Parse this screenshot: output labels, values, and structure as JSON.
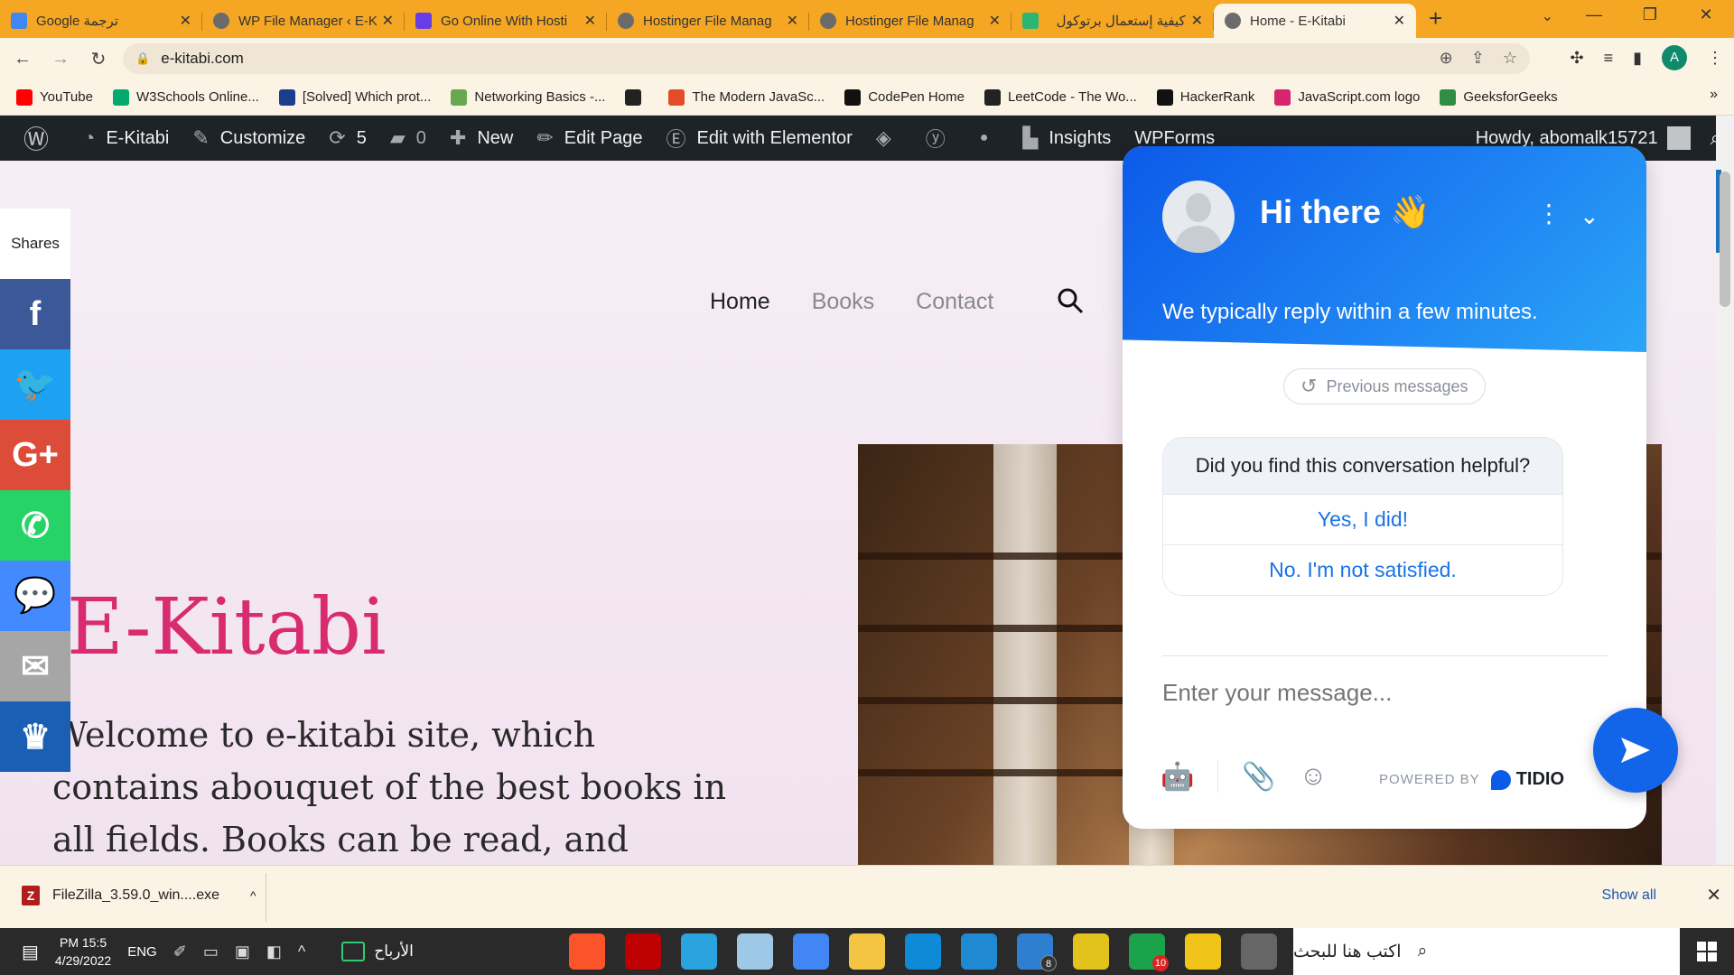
{
  "browser": {
    "tabs": [
      {
        "title": "Google ترجمة",
        "favicon": "google-translate-icon",
        "rtl": true
      },
      {
        "title": "WP File Manager ‹ E-K",
        "favicon": "globe-icon",
        "rtl": false
      },
      {
        "title": "Go Online With Hosti",
        "favicon": "hostinger-icon",
        "rtl": false
      },
      {
        "title": "Hostinger File Manag",
        "favicon": "globe-icon",
        "rtl": false
      },
      {
        "title": "Hostinger File Manag",
        "favicon": "globe-icon",
        "rtl": false
      },
      {
        "title": "كيفية إستعمال برتوكول",
        "favicon": "m-icon",
        "rtl": true
      },
      {
        "title": "Home - E-Kitabi",
        "favicon": "globe-icon",
        "rtl": false,
        "active": true
      }
    ],
    "url": "e-kitabi.com",
    "profile_initial": "A"
  },
  "bookmarks": [
    {
      "label": "YouTube",
      "color": "#ff0000"
    },
    {
      "label": "W3Schools Online...",
      "color": "#04aa6d"
    },
    {
      "label": "[Solved] Which prot...",
      "color": "#1a3e8c"
    },
    {
      "label": "Networking Basics -...",
      "color": "#6aa84f"
    },
    {
      "label": "",
      "color": "#222222"
    },
    {
      "label": "The Modern JavaSc...",
      "color": "#e34c26"
    },
    {
      "label": "CodePen Home",
      "color": "#111111"
    },
    {
      "label": "LeetCode - The Wo...",
      "color": "#222222"
    },
    {
      "label": "HackerRank",
      "color": "#111111"
    },
    {
      "label": "JavaScript.com logo",
      "color": "#d6246e"
    },
    {
      "label": "GeeksforGeeks",
      "color": "#2f8d46"
    }
  ],
  "adminbar": {
    "site": "E-Kitabi",
    "customize": "Customize",
    "updates": "5",
    "comments": "0",
    "new": "New",
    "edit_page": "Edit Page",
    "elementor": "Edit with Elementor",
    "insights": "Insights",
    "wpforms": "WPForms",
    "howdy": "Howdy, abomalk15721"
  },
  "site": {
    "nav": [
      "Home",
      "Books",
      "Contact"
    ],
    "title": "E-Kitabi",
    "intro": "Welcome to e-kitabi site, which contains abouquet of the best books in all fields. Books can be read, and downloaded"
  },
  "share": {
    "label": "Shares",
    "buttons": [
      {
        "name": "facebook",
        "glyph": "f",
        "color": "#3b5998"
      },
      {
        "name": "twitter",
        "glyph": "🐦",
        "color": "#1da1f2"
      },
      {
        "name": "google-plus",
        "glyph": "G+",
        "color": "#dd4b39"
      },
      {
        "name": "whatsapp",
        "glyph": "✆",
        "color": "#25d366"
      },
      {
        "name": "messenger",
        "glyph": "💬",
        "color": "#448aff"
      },
      {
        "name": "email",
        "glyph": "✉",
        "color": "#a6a6a6"
      },
      {
        "name": "crown",
        "glyph": "♛",
        "color": "#1a5fb4"
      }
    ]
  },
  "chat": {
    "greeting": "Hi there 👋",
    "reply_time": "We typically reply within a few minutes.",
    "previous_messages": "Previous messages",
    "question": "Did you find this conversation helpful?",
    "option_yes": "Yes, I did!",
    "option_no": "No. I'm not satisfied.",
    "input_placeholder": "Enter your message...",
    "powered_by": "POWERED BY",
    "brand": "TIDIO"
  },
  "downloads": {
    "file": "FileZilla_3.59.0_win....exe",
    "show_all": "Show all"
  },
  "taskbar": {
    "time": "PM 15:5",
    "date": "4/29/2022",
    "lang": "ENG",
    "weather": "الأرباح",
    "search_placeholder": "اكتب هنا للبحث",
    "apps": [
      {
        "name": "brave",
        "color": "#fb542b",
        "badge": ""
      },
      {
        "name": "filezilla",
        "color": "#bf0000",
        "badge": ""
      },
      {
        "name": "telegram",
        "color": "#2aa3df",
        "badge": ""
      },
      {
        "name": "notepad",
        "color": "#9ec9e6",
        "badge": ""
      },
      {
        "name": "chrome",
        "color": "#4285f4",
        "badge": ""
      },
      {
        "name": "file-explorer",
        "color": "#f4c542",
        "badge": ""
      },
      {
        "name": "edge",
        "color": "#0f8ad6",
        "badge": ""
      },
      {
        "name": "vscode",
        "color": "#1f8ad2",
        "badge": ""
      },
      {
        "name": "mail",
        "color": "#2f7fd1",
        "badge": "8"
      },
      {
        "name": "xampp",
        "color": "#e2c21c",
        "badge": ""
      },
      {
        "name": "antivirus",
        "color": "#1aa34a",
        "badge": "10"
      },
      {
        "name": "store",
        "color": "#f0c419",
        "badge": ""
      },
      {
        "name": "snipping",
        "color": "#666666",
        "badge": ""
      }
    ]
  }
}
